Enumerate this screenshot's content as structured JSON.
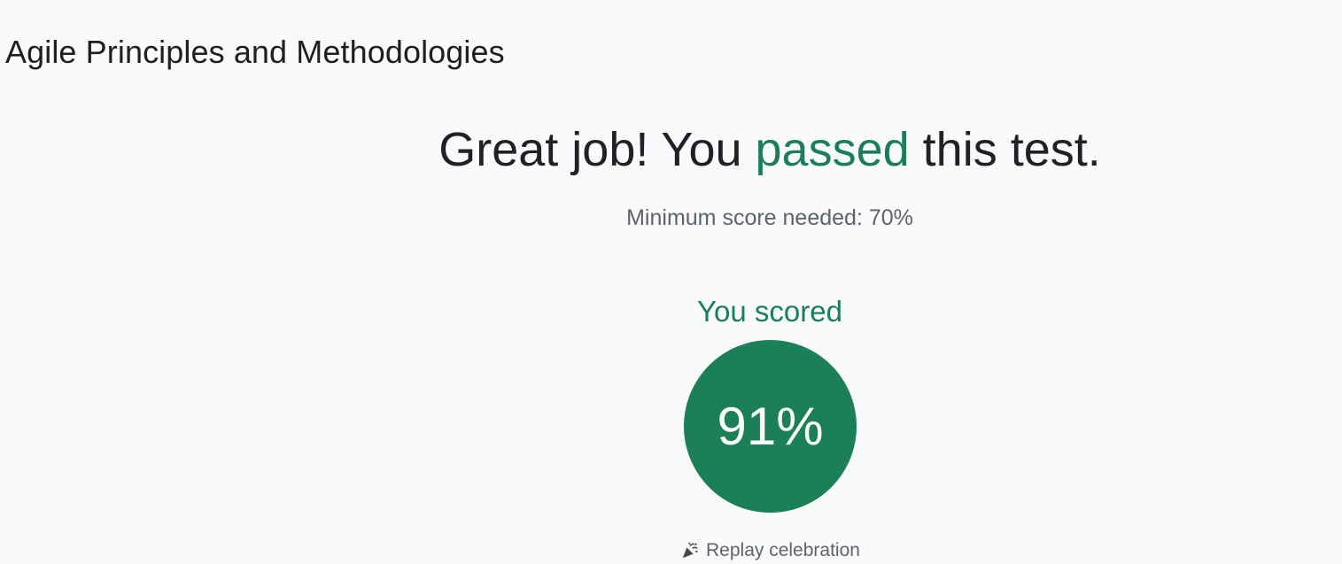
{
  "course": {
    "title": "Agile Principles and Methodologies"
  },
  "result": {
    "headline_before": "Great job! You ",
    "headline_highlight": "passed",
    "headline_after": " this test.",
    "minimum_score_text": "Minimum score needed: 70%",
    "you_scored_label": "You scored",
    "score_text": "91%",
    "score_value": 91,
    "minimum_score_value": 70
  },
  "actions": {
    "replay_label": "Replay celebration",
    "replay_icon": "party-popper-icon"
  },
  "colors": {
    "accent": "#1b7f58",
    "text_primary": "#202124",
    "text_secondary": "#5f6368",
    "background": "#f9fafc"
  }
}
